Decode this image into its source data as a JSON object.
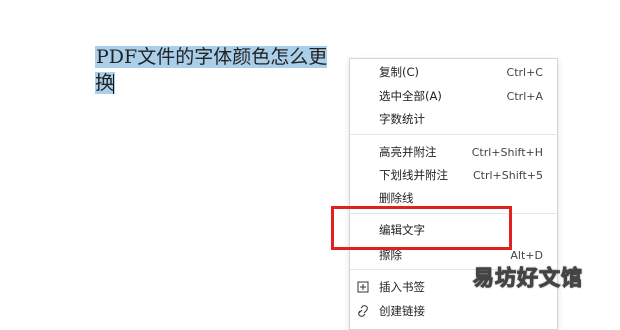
{
  "document": {
    "selected_text": "PDF文件的字体颜色怎么更换"
  },
  "context_menu": {
    "items": [
      {
        "label": "复制(C)",
        "shortcut": "Ctrl+C"
      },
      {
        "label": "选中全部(A)",
        "shortcut": "Ctrl+A"
      },
      {
        "label": "字数统计",
        "shortcut": ""
      },
      {
        "label": "高亮并附注",
        "shortcut": "Ctrl+Shift+H"
      },
      {
        "label": "下划线并附注",
        "shortcut": "Ctrl+Shift+5"
      },
      {
        "label": "删除线",
        "shortcut": ""
      },
      {
        "label": "编辑文字",
        "shortcut": ""
      },
      {
        "label": "擦除",
        "shortcut": "Alt+D"
      },
      {
        "label": "插入书签",
        "shortcut": ""
      },
      {
        "label": "创建链接",
        "shortcut": ""
      }
    ]
  },
  "annotation": {
    "highlight_color": "#e12020"
  },
  "watermark": {
    "text": "易坊好文馆"
  }
}
